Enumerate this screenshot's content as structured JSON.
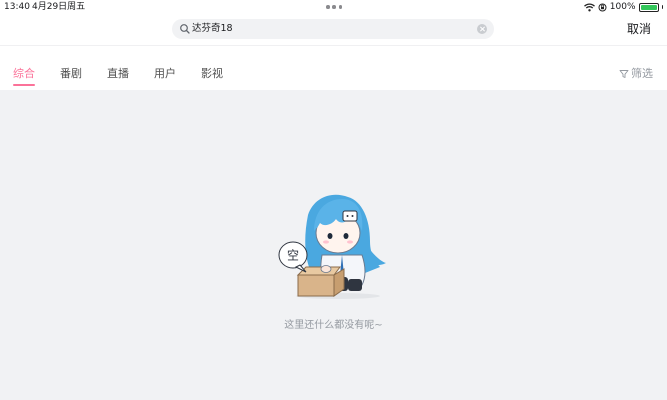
{
  "status_bar": {
    "time": "13:40",
    "date": "4月29日周五",
    "battery_text": "100%",
    "icons": [
      "wifi-icon",
      "orientation-lock-icon",
      "battery-icon"
    ]
  },
  "search": {
    "query": "达芬奇18",
    "cancel_label": "取消"
  },
  "tabs": [
    {
      "label": "综合",
      "active": true
    },
    {
      "label": "番剧",
      "active": false
    },
    {
      "label": "直播",
      "active": false
    },
    {
      "label": "用户",
      "active": false
    },
    {
      "label": "影视",
      "active": false
    }
  ],
  "filter_label": "筛选",
  "empty_state": {
    "bubble_text": "空",
    "message": "这里还什么都没有呢~"
  },
  "colors": {
    "accent": "#fb7299",
    "background": "#f1f2f4",
    "hair": "#5ab3e8",
    "muted_text": "#9499a0"
  }
}
